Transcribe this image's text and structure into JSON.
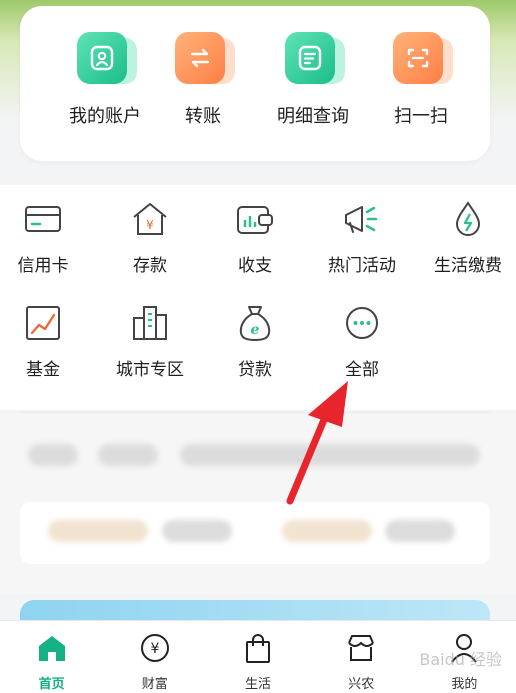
{
  "quick": [
    {
      "label": "我的账户",
      "icon": "account-icon",
      "color": "green"
    },
    {
      "label": "转账",
      "icon": "transfer-icon",
      "color": "orange"
    },
    {
      "label": "明细查询",
      "icon": "details-icon",
      "color": "green"
    },
    {
      "label": "扫一扫",
      "icon": "scan-icon",
      "color": "orange"
    }
  ],
  "services": [
    {
      "label": "信用卡",
      "icon": "credit-card-icon"
    },
    {
      "label": "存款",
      "icon": "deposit-icon"
    },
    {
      "label": "收支",
      "icon": "wallet-icon"
    },
    {
      "label": "热门活动",
      "icon": "megaphone-icon"
    },
    {
      "label": "生活缴费",
      "icon": "water-drop-icon"
    },
    {
      "label": "基金",
      "icon": "fund-chart-icon"
    },
    {
      "label": "城市专区",
      "icon": "city-buildings-icon"
    },
    {
      "label": "贷款",
      "icon": "loan-bag-icon"
    },
    {
      "label": "全部",
      "icon": "more-icon"
    }
  ],
  "tabs": [
    {
      "label": "首页",
      "icon": "home-icon",
      "active": true
    },
    {
      "label": "财富",
      "icon": "wealth-icon",
      "active": false
    },
    {
      "label": "生活",
      "icon": "shopping-bag-icon",
      "active": false
    },
    {
      "label": "兴农",
      "icon": "store-icon",
      "active": false
    },
    {
      "label": "我的",
      "icon": "profile-icon",
      "active": false
    }
  ],
  "colors": {
    "accent_green": "#16b086",
    "orange": "#ff7f45",
    "icon_green": "#2fbf8e",
    "arrow_red": "#e8242c"
  },
  "watermark": "Baidu 经验"
}
